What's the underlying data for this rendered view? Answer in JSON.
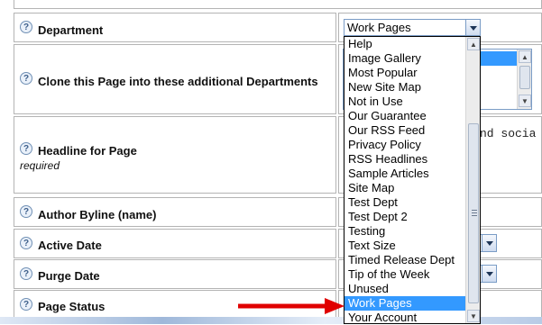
{
  "fields": [
    {
      "label": "Department",
      "sublabel": ""
    },
    {
      "label": "Clone this Page into these additional Departments",
      "sublabel": ""
    },
    {
      "label": "Headline for Page",
      "sublabel": "required"
    },
    {
      "label": "Author Byline (name)",
      "sublabel": ""
    },
    {
      "label": "Active Date",
      "sublabel": ""
    },
    {
      "label": "Purge Date",
      "sublabel": ""
    },
    {
      "label": "Page Status",
      "sublabel": ""
    }
  ],
  "help_icon_glyph": "?",
  "department_select": {
    "value": "Work Pages",
    "options": [
      "Help",
      "Image Gallery",
      "Most Popular",
      "New Site Map",
      "Not in Use",
      "Our Guarantee",
      "Our RSS Feed",
      "Privacy Policy",
      "RSS Headlines",
      "Sample Articles",
      "Site Map",
      "Test Dept",
      "Test Dept 2",
      "Testing",
      "Text Size",
      "Timed Release Dept",
      "Tip of the Week",
      "Unused",
      "Work Pages",
      "Your Account"
    ],
    "highlighted_option": "Work Pages"
  },
  "headline_value_fragment": "nd socia",
  "colors": {
    "highlight": "#3399ff",
    "arrow": "#e00000",
    "border": "#b4b4b4"
  }
}
